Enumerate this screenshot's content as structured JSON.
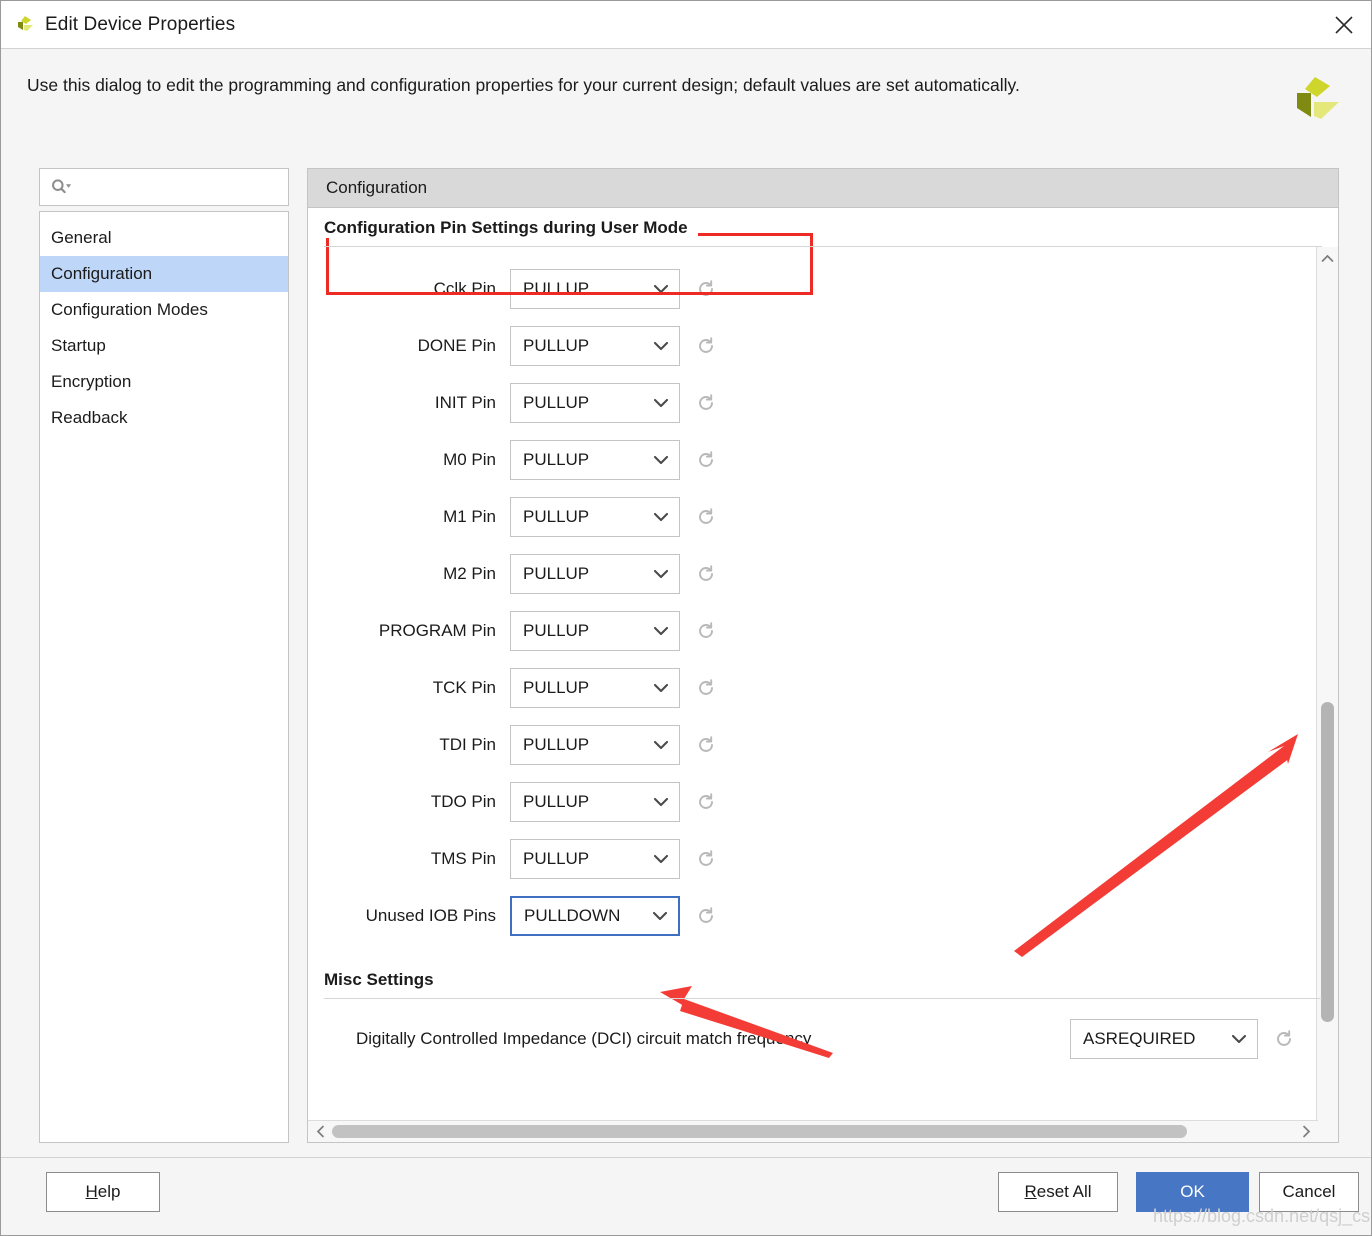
{
  "window": {
    "title": "Edit Device Properties",
    "logo_icon": "xilinx-logo-icon",
    "close_icon": "close-icon"
  },
  "instruction": {
    "text": "Use this dialog to edit the programming and configuration properties for your current design; default values are set automatically.",
    "brand_icon": "xilinx-brand-logo-icon"
  },
  "search": {
    "icon": "search-icon",
    "value": "",
    "placeholder": ""
  },
  "sidebar": {
    "items": [
      {
        "label": "General",
        "selected": false
      },
      {
        "label": "Configuration",
        "selected": true
      },
      {
        "label": "Configuration Modes",
        "selected": false
      },
      {
        "label": "Startup",
        "selected": false
      },
      {
        "label": "Encryption",
        "selected": false
      },
      {
        "label": "Readback",
        "selected": false
      }
    ]
  },
  "panel": {
    "header_title": "Configuration",
    "sections": [
      {
        "title": "Configuration Pin Settings during User Mode",
        "highlighted": true
      },
      {
        "title": "Misc Settings",
        "highlighted": false
      }
    ],
    "pin_rows": [
      {
        "label": "Cclk Pin",
        "value": "PULLUP",
        "focused": false,
        "reset_icon": "reset-icon"
      },
      {
        "label": "DONE Pin",
        "value": "PULLUP",
        "focused": false,
        "reset_icon": "reset-icon"
      },
      {
        "label": "INIT Pin",
        "value": "PULLUP",
        "focused": false,
        "reset_icon": "reset-icon"
      },
      {
        "label": "M0 Pin",
        "value": "PULLUP",
        "focused": false,
        "reset_icon": "reset-icon"
      },
      {
        "label": "M1 Pin",
        "value": "PULLUP",
        "focused": false,
        "reset_icon": "reset-icon"
      },
      {
        "label": "M2 Pin",
        "value": "PULLUP",
        "focused": false,
        "reset_icon": "reset-icon"
      },
      {
        "label": "PROGRAM Pin",
        "value": "PULLUP",
        "focused": false,
        "reset_icon": "reset-icon"
      },
      {
        "label": "TCK Pin",
        "value": "PULLUP",
        "focused": false,
        "reset_icon": "reset-icon"
      },
      {
        "label": "TDI Pin",
        "value": "PULLUP",
        "focused": false,
        "reset_icon": "reset-icon"
      },
      {
        "label": "TDO Pin",
        "value": "PULLUP",
        "focused": false,
        "reset_icon": "reset-icon"
      },
      {
        "label": "TMS Pin",
        "value": "PULLUP",
        "focused": false,
        "reset_icon": "reset-icon"
      },
      {
        "label": "Unused IOB Pins",
        "value": "PULLDOWN",
        "focused": true,
        "reset_icon": "reset-icon"
      }
    ],
    "misc_rows": [
      {
        "label": "Digitally Controlled Impedance (DCI) circuit match frequency",
        "value": "ASREQUIRED",
        "reset_icon": "reset-icon"
      }
    ]
  },
  "buttons": {
    "help": {
      "mnemonic": "H",
      "rest": "elp"
    },
    "reset": {
      "mnemonic": "R",
      "rest": "eset All"
    },
    "ok": {
      "label": "OK"
    },
    "cancel": {
      "label": "Cancel"
    }
  },
  "watermark": {
    "text": "https://blog.csdn.net/qsj_csdn"
  },
  "colors": {
    "accent": "#4777c4",
    "selection": "#bed6f8",
    "annotation": "#ee2a24",
    "focus_border": "#3f6fc0",
    "panel_header": "#d9d9d9"
  }
}
